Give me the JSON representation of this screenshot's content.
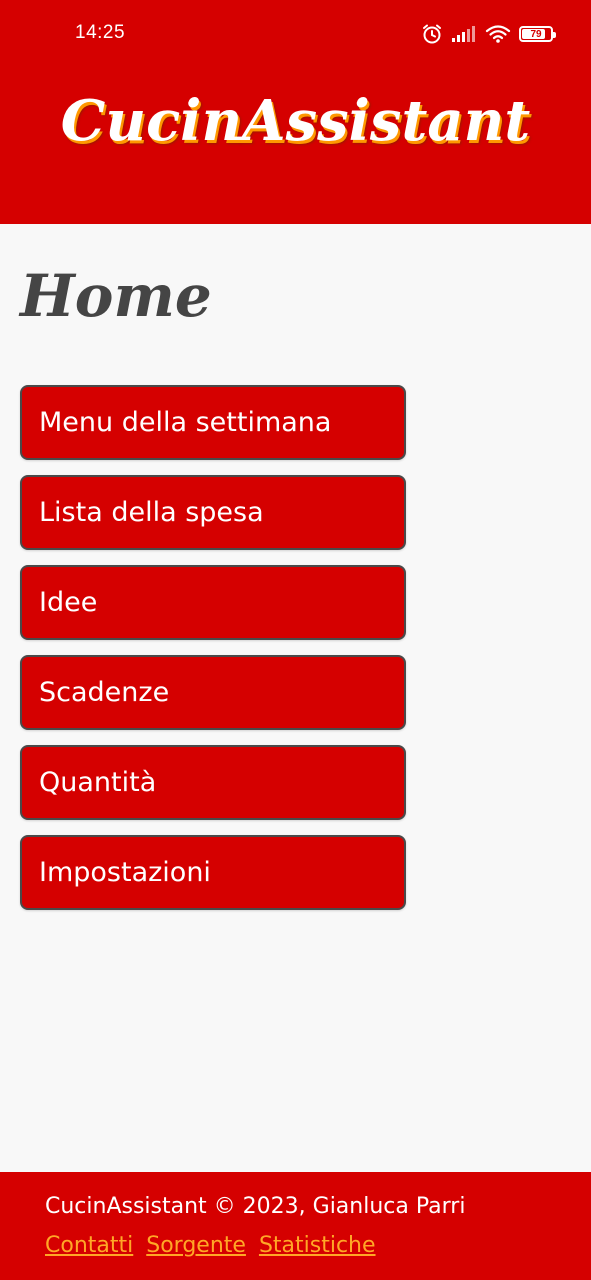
{
  "status_bar": {
    "time": "14:25",
    "battery_level": "79",
    "icons": [
      "alarm-icon",
      "signal-icon",
      "wifi-icon",
      "battery-icon"
    ]
  },
  "header": {
    "app_title": "CucinAssistant"
  },
  "main": {
    "page_title": "Home",
    "menu_items": [
      {
        "label": "Menu della settimana"
      },
      {
        "label": "Lista della spesa"
      },
      {
        "label": "Idee"
      },
      {
        "label": "Scadenze"
      },
      {
        "label": "Quantità"
      },
      {
        "label": "Impostazioni"
      }
    ]
  },
  "footer": {
    "copyright": "CucinAssistant © 2023, Gianluca Parri",
    "links": [
      {
        "label": "Contatti"
      },
      {
        "label": "Sorgente"
      },
      {
        "label": "Statistiche"
      }
    ]
  },
  "colors": {
    "primary": "#d50000",
    "background": "#f8f8f8",
    "link": "#ffa726",
    "title_shadow": "#ff9800",
    "border": "#4a4a4a"
  }
}
